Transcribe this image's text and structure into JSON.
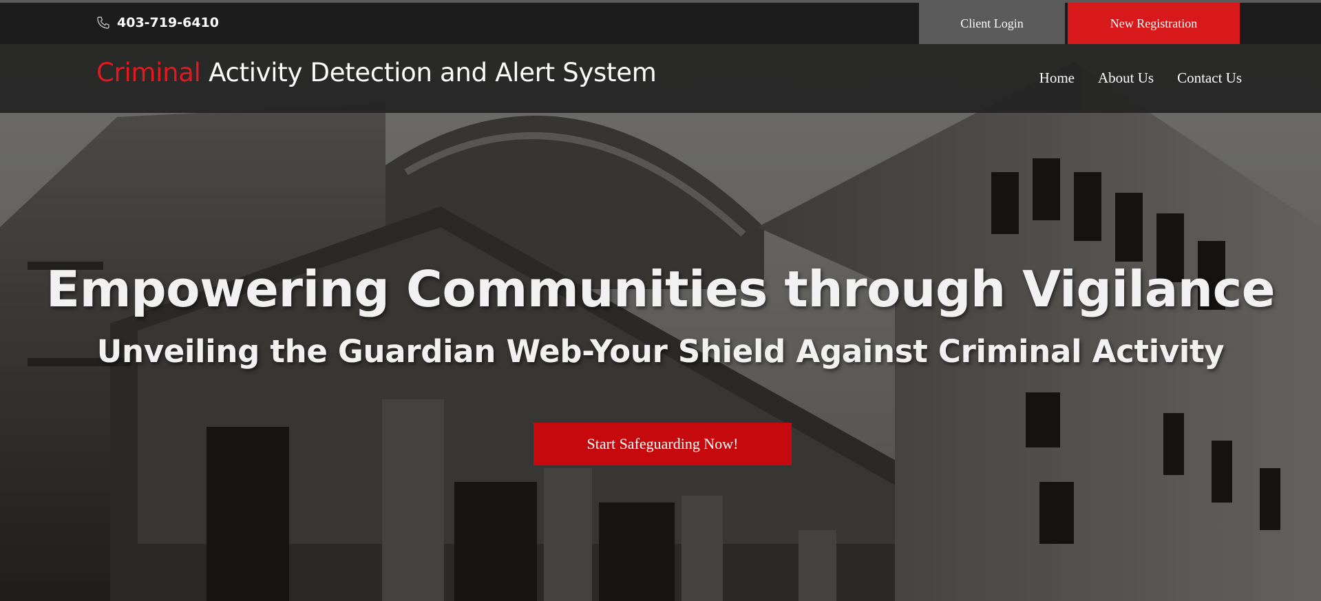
{
  "topbar": {
    "phone_icon": "phone-icon",
    "phone": "403-719-6410",
    "client_login_label": "Client Login",
    "new_registration_label": "New Registration"
  },
  "navbar": {
    "brand_accent": "Criminal",
    "brand_rest": " Activity Detection and Alert System",
    "links": [
      "Home",
      "About Us",
      "Contact Us"
    ]
  },
  "hero": {
    "title": "Empowering Communities through Vigilance",
    "subtitle": "Unveiling the Guardian Web-Your Shield Against Criminal Activity",
    "cta_label": "Start Safeguarding Now!"
  },
  "colors": {
    "accent_red": "#d8191c",
    "topbar_bg": "#1c1c1c",
    "login_bg": "#5b5b5b"
  }
}
